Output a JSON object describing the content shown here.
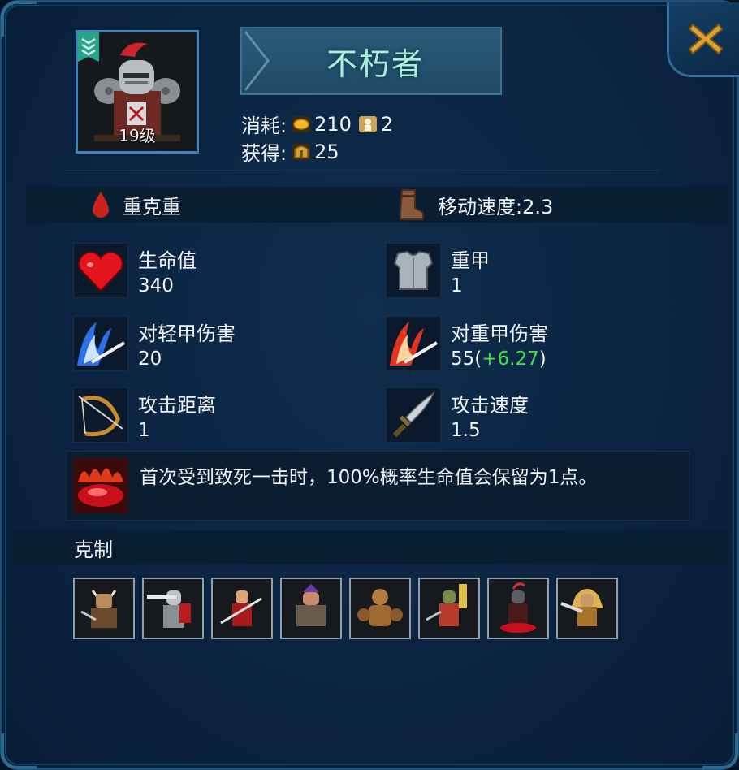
{
  "unit": {
    "name": "不朽者",
    "level_label": "19级",
    "portrait_icon": "armored-knight-portrait",
    "rank_icon": "rank-chevron-badge-icon"
  },
  "cost": {
    "label": "消耗:",
    "items": [
      {
        "icon": "gold-coin-icon",
        "value": "210"
      },
      {
        "icon": "population-icon",
        "value": "2"
      }
    ]
  },
  "reward": {
    "label": "获得:",
    "items": [
      {
        "icon": "resource-chest-icon",
        "value": "25"
      }
    ]
  },
  "traits": {
    "armor_relation": "重克重",
    "move_speed": "移动速度:2.3"
  },
  "stats": [
    {
      "name": "生命值",
      "value": "340",
      "icon": "heart-icon"
    },
    {
      "name": "重甲",
      "value": "1",
      "icon": "heavy-armor-icon"
    },
    {
      "name": "对轻甲伤害",
      "value": "20",
      "icon": "blue-slash-icon"
    },
    {
      "name": "对重甲伤害",
      "value": "55(",
      "bonus": "+6.27",
      "value_suffix": ")",
      "icon": "red-slash-icon"
    },
    {
      "name": "攻击距离",
      "value": "1",
      "icon": "bow-icon"
    },
    {
      "name": "攻击速度",
      "value": "1.5",
      "icon": "dagger-icon"
    }
  ],
  "passive": {
    "text": "首次受到致死一击时，100%概率生命值会保留为1点。",
    "icon": "blood-pool-icon"
  },
  "counters": {
    "label": "克制",
    "units": [
      "horned-warrior",
      "sword-knight",
      "red-ninja",
      "purple-brawler",
      "golem",
      "archer-soldier",
      "crimson-knight",
      "golden-berserker"
    ]
  },
  "colors": {
    "title_text": "#a6f0dc",
    "bonus_text": "#3ee24a",
    "panel_bg": "#0b2442",
    "close_icon": "#d9a23a"
  }
}
